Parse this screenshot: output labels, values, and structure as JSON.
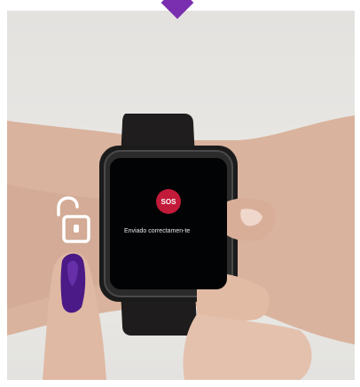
{
  "watch": {
    "sos_label": "SOS",
    "status_text": "Enviado correctamen-te"
  },
  "icons": {
    "unlock": "unlock-icon",
    "pointer": "triangle-down-icon"
  },
  "colors": {
    "accent": "#7a2fb0",
    "sos": "#c21a39",
    "screen": "#020304"
  }
}
